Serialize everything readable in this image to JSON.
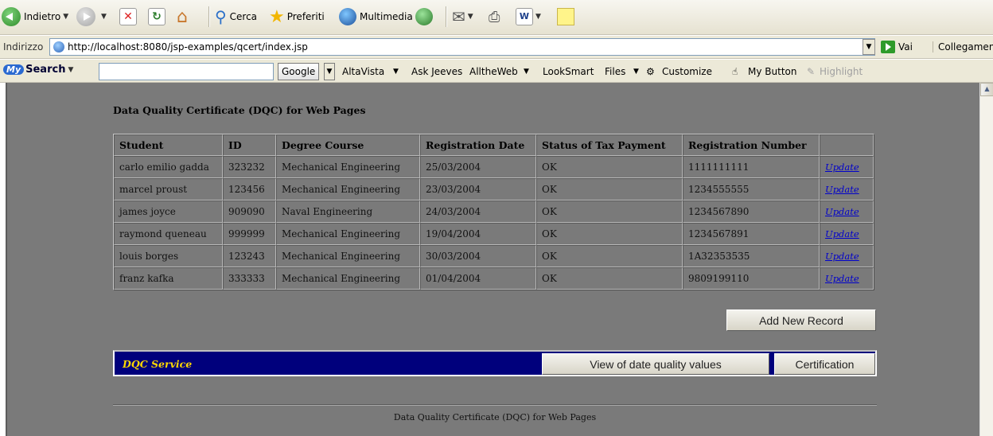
{
  "toolbar": {
    "back_label": "Indietro",
    "search_label": "Cerca",
    "favorites_label": "Preferiti",
    "media_label": "Multimedia"
  },
  "address": {
    "label": "Indirizzo",
    "url": "http://localhost:8080/jsp-examples/qcert/index.jsp",
    "go_label": "Vai",
    "links_label": "Collegamenti"
  },
  "searchbar": {
    "brand": "Search",
    "brand_badge": "My",
    "query": "",
    "engine": "Google",
    "links": [
      "AltaVista",
      "Ask Jeeves",
      "AlltheWeb",
      "LookSmart",
      "Files",
      "Customize",
      "My Button",
      "Highlight"
    ]
  },
  "page": {
    "title": "Data Quality Certificate (DQC) for Web Pages",
    "columns": [
      "Student",
      "ID",
      "Degree Course",
      "Registration Date",
      "Status of Tax Payment",
      "Registration Number",
      ""
    ],
    "rows": [
      {
        "student": "carlo emilio gadda",
        "id": "323232",
        "course": "Mechanical Engineering",
        "date": "25/03/2004",
        "tax": "OK",
        "regnum": "1111111111",
        "action": "Update"
      },
      {
        "student": "marcel proust",
        "id": "123456",
        "course": "Mechanical Engineering",
        "date": "23/03/2004",
        "tax": "OK",
        "regnum": "1234555555",
        "action": "Update"
      },
      {
        "student": "james joyce",
        "id": "909090",
        "course": "Naval Engineering",
        "date": "24/03/2004",
        "tax": "OK",
        "regnum": "1234567890",
        "action": "Update"
      },
      {
        "student": "raymond queneau",
        "id": "999999",
        "course": "Mechanical Engineering",
        "date": "19/04/2004",
        "tax": "OK",
        "regnum": "1234567891",
        "action": "Update"
      },
      {
        "student": "louis borges",
        "id": "123243",
        "course": "Mechanical Engineering",
        "date": "30/03/2004",
        "tax": "OK",
        "regnum": "1A32353535",
        "action": "Update"
      },
      {
        "student": "franz kafka",
        "id": "333333",
        "course": "Mechanical Engineering",
        "date": "01/04/2004",
        "tax": "OK",
        "regnum": "9809199110",
        "action": "Update"
      }
    ],
    "add_button": "Add New Record",
    "service_title": "DQC Service",
    "view_button": "View of date quality values",
    "cert_button": "Certification",
    "footer": "Data Quality Certificate (DQC) for Web Pages"
  },
  "colors": {
    "page_bg": "#7a7a7a",
    "service_bar": "#00007c",
    "service_title": "#ffd800",
    "link": "#0000cc"
  }
}
